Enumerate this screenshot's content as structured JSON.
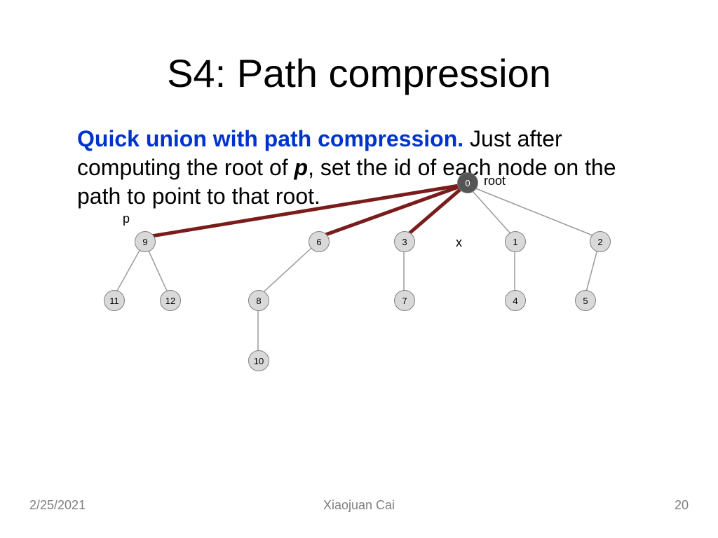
{
  "title": "S4: Path compression",
  "lead": "Quick union with path compression.",
  "rest1": "  Just after computing the root of ",
  "p": "p",
  "rest2": ", set the id of each node on the path to point to that root.",
  "labels": {
    "p": "p",
    "root": "root",
    "x": "x"
  },
  "nodes": {
    "n0": "0",
    "n1": "1",
    "n2": "2",
    "n3": "3",
    "n4": "4",
    "n5": "5",
    "n6": "6",
    "n7": "7",
    "n8": "8",
    "n9": "9",
    "n10": "10",
    "n11": "11",
    "n12": "12"
  },
  "footer": {
    "date": "2/25/2021",
    "author": "Xiaojuan Cai",
    "page": "20"
  },
  "chart_data": {
    "type": "diagram",
    "description": "Union-find tree after path compression",
    "root": 0,
    "tree_edges": [
      [
        0,
        9
      ],
      [
        0,
        6
      ],
      [
        0,
        3
      ],
      [
        0,
        1
      ],
      [
        0,
        2
      ],
      [
        9,
        11
      ],
      [
        9,
        12
      ],
      [
        6,
        8
      ],
      [
        3,
        7
      ],
      [
        1,
        4
      ],
      [
        2,
        5
      ],
      [
        8,
        10
      ]
    ],
    "compressed_path_to_root": [
      9,
      6,
      3,
      0
    ],
    "annotations": {
      "p": 9,
      "root": 0,
      "x": "between 3 and 1"
    }
  }
}
